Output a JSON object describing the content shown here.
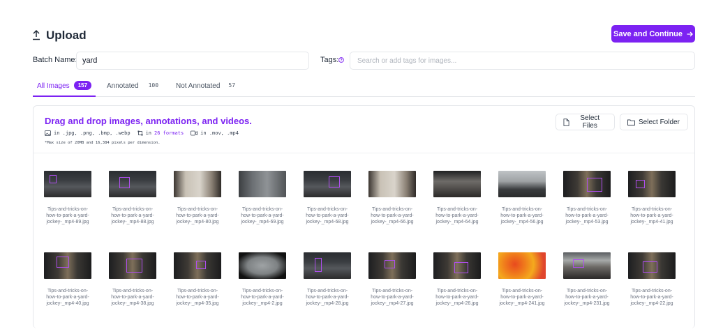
{
  "header": {
    "title": "Upload",
    "save_button": "Save and Continue"
  },
  "form": {
    "batch_label": "Batch Name:",
    "batch_value": "yard",
    "tags_label": "Tags:",
    "tags_placeholder": "Search or add tags for images..."
  },
  "tabs": [
    {
      "label": "All Images",
      "count": "157",
      "active": true
    },
    {
      "label": "Annotated",
      "count": "100",
      "active": false
    },
    {
      "label": "Not Annotated",
      "count": "57",
      "active": false
    }
  ],
  "dropzone": {
    "title": "Drag and drop images, annotations, and videos.",
    "image_formats": "in .jpg, .png, .bmp, .webp",
    "annotation_formats_prefix": "in",
    "annotation_formats_link": "26 formats",
    "video_formats": "in .mov, .mp4",
    "max_size": "Max size of 20MB and 16,384 pixels per dimension.",
    "select_files": "Select Files",
    "select_folder": "Select Folder"
  },
  "images": [
    {
      "caption": [
        "Tips-and-tricks-on-",
        "how-to-park-a-yard-",
        "jockey-_mp4-89.jpg"
      ],
      "theme": "cab-dark"
    },
    {
      "caption": [
        "Tips-and-tricks-on-",
        "how-to-park-a-yard-",
        "jockey-_mp4-88.jpg"
      ],
      "theme": "cab-dark"
    },
    {
      "caption": [
        "Tips-and-tricks-on-",
        "how-to-park-a-yard-",
        "jockey-_mp4-80.jpg"
      ],
      "theme": "cab-light"
    },
    {
      "caption": [
        "Tips-and-tricks-on-",
        "how-to-park-a-yard-",
        "jockey-_mp4-69.jpg"
      ],
      "theme": "cab-grey"
    },
    {
      "caption": [
        "Tips-and-tricks-on-",
        "how-to-park-a-yard-",
        "jockey-_mp4-68.jpg"
      ],
      "theme": "cab-dark"
    },
    {
      "caption": [
        "Tips-and-tricks-on-",
        "how-to-park-a-yard-",
        "jockey-_mp4-66.jpg"
      ],
      "theme": "cab-light"
    },
    {
      "caption": [
        "Tips-and-tricks-on-",
        "how-to-park-a-yard-",
        "jockey-_mp4-64.jpg"
      ],
      "theme": "cab-wheel"
    },
    {
      "caption": [
        "Tips-and-tricks-on-",
        "how-to-park-a-yard-",
        "jockey-_mp4-56.jpg"
      ],
      "theme": "yard"
    },
    {
      "caption": [
        "Tips-and-tricks-on-",
        "how-to-park-a-yard-",
        "jockey-_mp4-53.jpg"
      ],
      "theme": "cab-sign"
    },
    {
      "caption": [
        "Tips-and-tricks-on-",
        "how-to-park-a-yard-",
        "jockey-_mp4-41.jpg"
      ],
      "theme": "cab-sign"
    },
    {
      "caption": [
        "Tips-and-tricks-on-",
        "how-to-park-a-yard-",
        "jockey-_mp4-40.jpg"
      ],
      "theme": "cab-sign"
    },
    {
      "caption": [
        "Tips-and-tricks-on-",
        "how-to-park-a-yard-",
        "jockey-_mp4-38.jpg"
      ],
      "theme": "cab-sign"
    },
    {
      "caption": [
        "Tips-and-tricks-on-",
        "how-to-park-a-yard-",
        "jockey-_mp4-35.jpg"
      ],
      "theme": "cab-sign"
    },
    {
      "caption": [
        "Tips-and-tricks-on-",
        "how-to-park-a-yard-",
        "jockey-_mp4-2.jpg"
      ],
      "theme": "windshield"
    },
    {
      "caption": [
        "Tips-and-tricks-on-",
        "how-to-park-a-yard-",
        "jockey-_mp4-28.jpg"
      ],
      "theme": "cab-dark"
    },
    {
      "caption": [
        "Tips-and-tricks-on-",
        "how-to-park-a-yard-",
        "jockey-_mp4-27.jpg"
      ],
      "theme": "cab-sign"
    },
    {
      "caption": [
        "Tips-and-tricks-on-",
        "how-to-park-a-yard-",
        "jockey-_mp4-26.jpg"
      ],
      "theme": "cab-sign"
    },
    {
      "caption": [
        "Tips-and-tricks-on-",
        "how-to-park-a-yard-",
        "jockey-_mp4-241.jpg"
      ],
      "theme": "heat"
    },
    {
      "caption": [
        "Tips-and-tricks-on-",
        "how-to-park-a-yard-",
        "jockey-_mp4-231.jpg"
      ],
      "theme": "dock"
    },
    {
      "caption": [
        "Tips-and-tricks-on-",
        "how-to-park-a-yard-",
        "jockey-_mp4-22.jpg"
      ],
      "theme": "cab-sign"
    }
  ],
  "colors": {
    "accent": "#7c22f2",
    "annotation_box": "#b04ef0"
  }
}
